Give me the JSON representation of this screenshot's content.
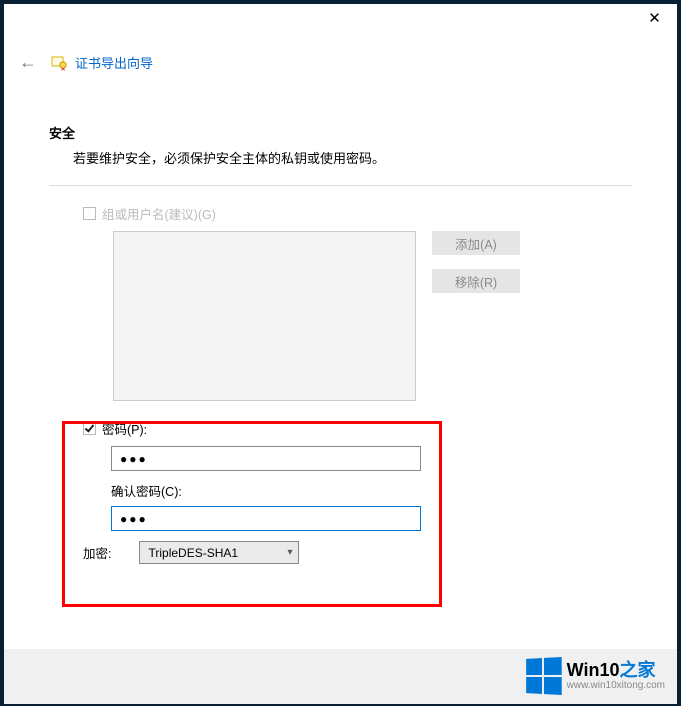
{
  "window": {
    "close_symbol": "✕"
  },
  "header": {
    "back_symbol": "←",
    "title": "证书导出向导"
  },
  "security": {
    "title": "安全",
    "description": "若要维护安全，必须保护安全主体的私钥或使用密码。"
  },
  "group": {
    "checked": false,
    "label": "组或用户名(建议)(G)"
  },
  "buttons": {
    "add": "添加(A)",
    "remove": "移除(R)"
  },
  "password": {
    "checked": true,
    "label": "密码(P):",
    "value": "●●●",
    "confirm_label": "确认密码(C):",
    "confirm_value": "●●●"
  },
  "encryption": {
    "label": "加密:",
    "selected": "TripleDES-SHA1"
  },
  "watermark": {
    "brand_a": "Win10",
    "brand_b": "之家",
    "url": "www.win10xitong.com"
  }
}
